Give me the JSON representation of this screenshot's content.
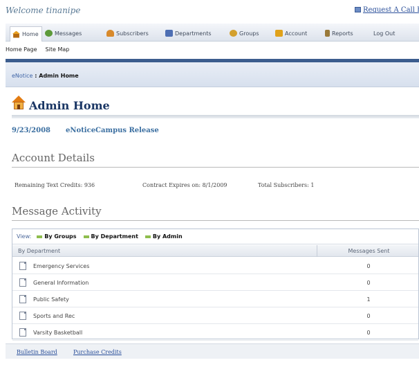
{
  "header": {
    "welcome": "Welcome tinanipe",
    "callback_link": "Request A Call Back"
  },
  "nav": {
    "items": [
      {
        "label": "Home",
        "icon": "home-icon"
      },
      {
        "label": "Messages",
        "icon": "messages-icon"
      },
      {
        "label": "Subscribers",
        "icon": "subscribers-icon"
      },
      {
        "label": "Departments",
        "icon": "departments-icon"
      },
      {
        "label": "Groups",
        "icon": "groups-icon"
      },
      {
        "label": "Account",
        "icon": "account-icon"
      },
      {
        "label": "Reports",
        "icon": "reports-icon"
      },
      {
        "label": "Log Out"
      }
    ]
  },
  "subnav": {
    "items": [
      "Home Page",
      "Site Map"
    ]
  },
  "breadcrumb": {
    "root": "eNotice",
    "sep": " : ",
    "current": "Admin Home"
  },
  "page": {
    "title": "Admin Home",
    "release_date": "9/23/2008",
    "release_label": "eNoticeCampus Release"
  },
  "account": {
    "heading": "Account Details",
    "remaining": "Remaining Text Credits: 936",
    "contract": "Contract Expires on: 8/1/2009",
    "subscribers": "Total Subscribers: 1"
  },
  "activity": {
    "heading": "Message Activity",
    "view_label": "View:",
    "options": [
      "By Groups",
      "By Department",
      "By Admin"
    ],
    "col_department": "By Department",
    "col_sent": "Messages Sent",
    "rows": [
      {
        "name": "Emergency Services",
        "sent": "0"
      },
      {
        "name": "General Information",
        "sent": "0"
      },
      {
        "name": "Public Safety",
        "sent": "1"
      },
      {
        "name": "Sports and Rec",
        "sent": "0"
      },
      {
        "name": "Varsity Basketball",
        "sent": "0"
      }
    ]
  },
  "footer": {
    "links": [
      "Bulletin Board",
      "Purchase Credits"
    ]
  }
}
